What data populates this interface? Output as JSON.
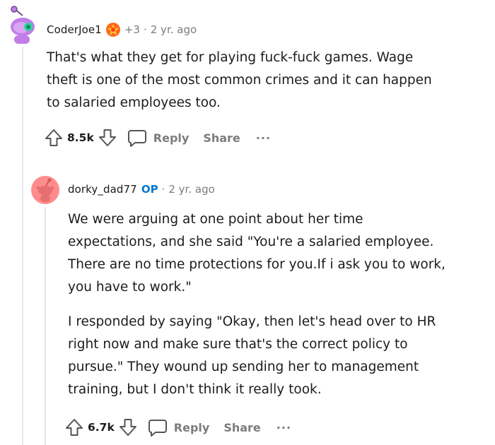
{
  "comments": [
    {
      "author": "CoderJoe1",
      "flair_score": "+3",
      "separator": "·",
      "time": "2 yr. ago",
      "body": [
        "That's what they get for playing fuck-fuck games. Wage theft is one of the most common crimes and it can happen to salaried employees too."
      ],
      "votes": "8.5k",
      "reply_label": "Reply",
      "share_label": "Share",
      "more_label": "···",
      "avatar_color": "#c17ee8"
    },
    {
      "author": "dorky_dad77",
      "op_label": "OP",
      "separator": "·",
      "time": "2 yr. ago",
      "body": [
        "We were arguing at one point about her time expectations, and she said \"You're a salaried employee. There are no time protections for you.If i ask you to work, you have to work.\"",
        "I responded by saying \"Okay, then let's head over to HR right now and make sure that's the correct policy to pursue.\" They wound up sending her to management training, but I don't think it really took."
      ],
      "votes": "6.7k",
      "reply_label": "Reply",
      "share_label": "Share",
      "more_label": "···",
      "avatar_color": "#ff8c8c"
    }
  ],
  "colors": {
    "accent": "#0079d3",
    "thread": "#e5e7ea"
  }
}
